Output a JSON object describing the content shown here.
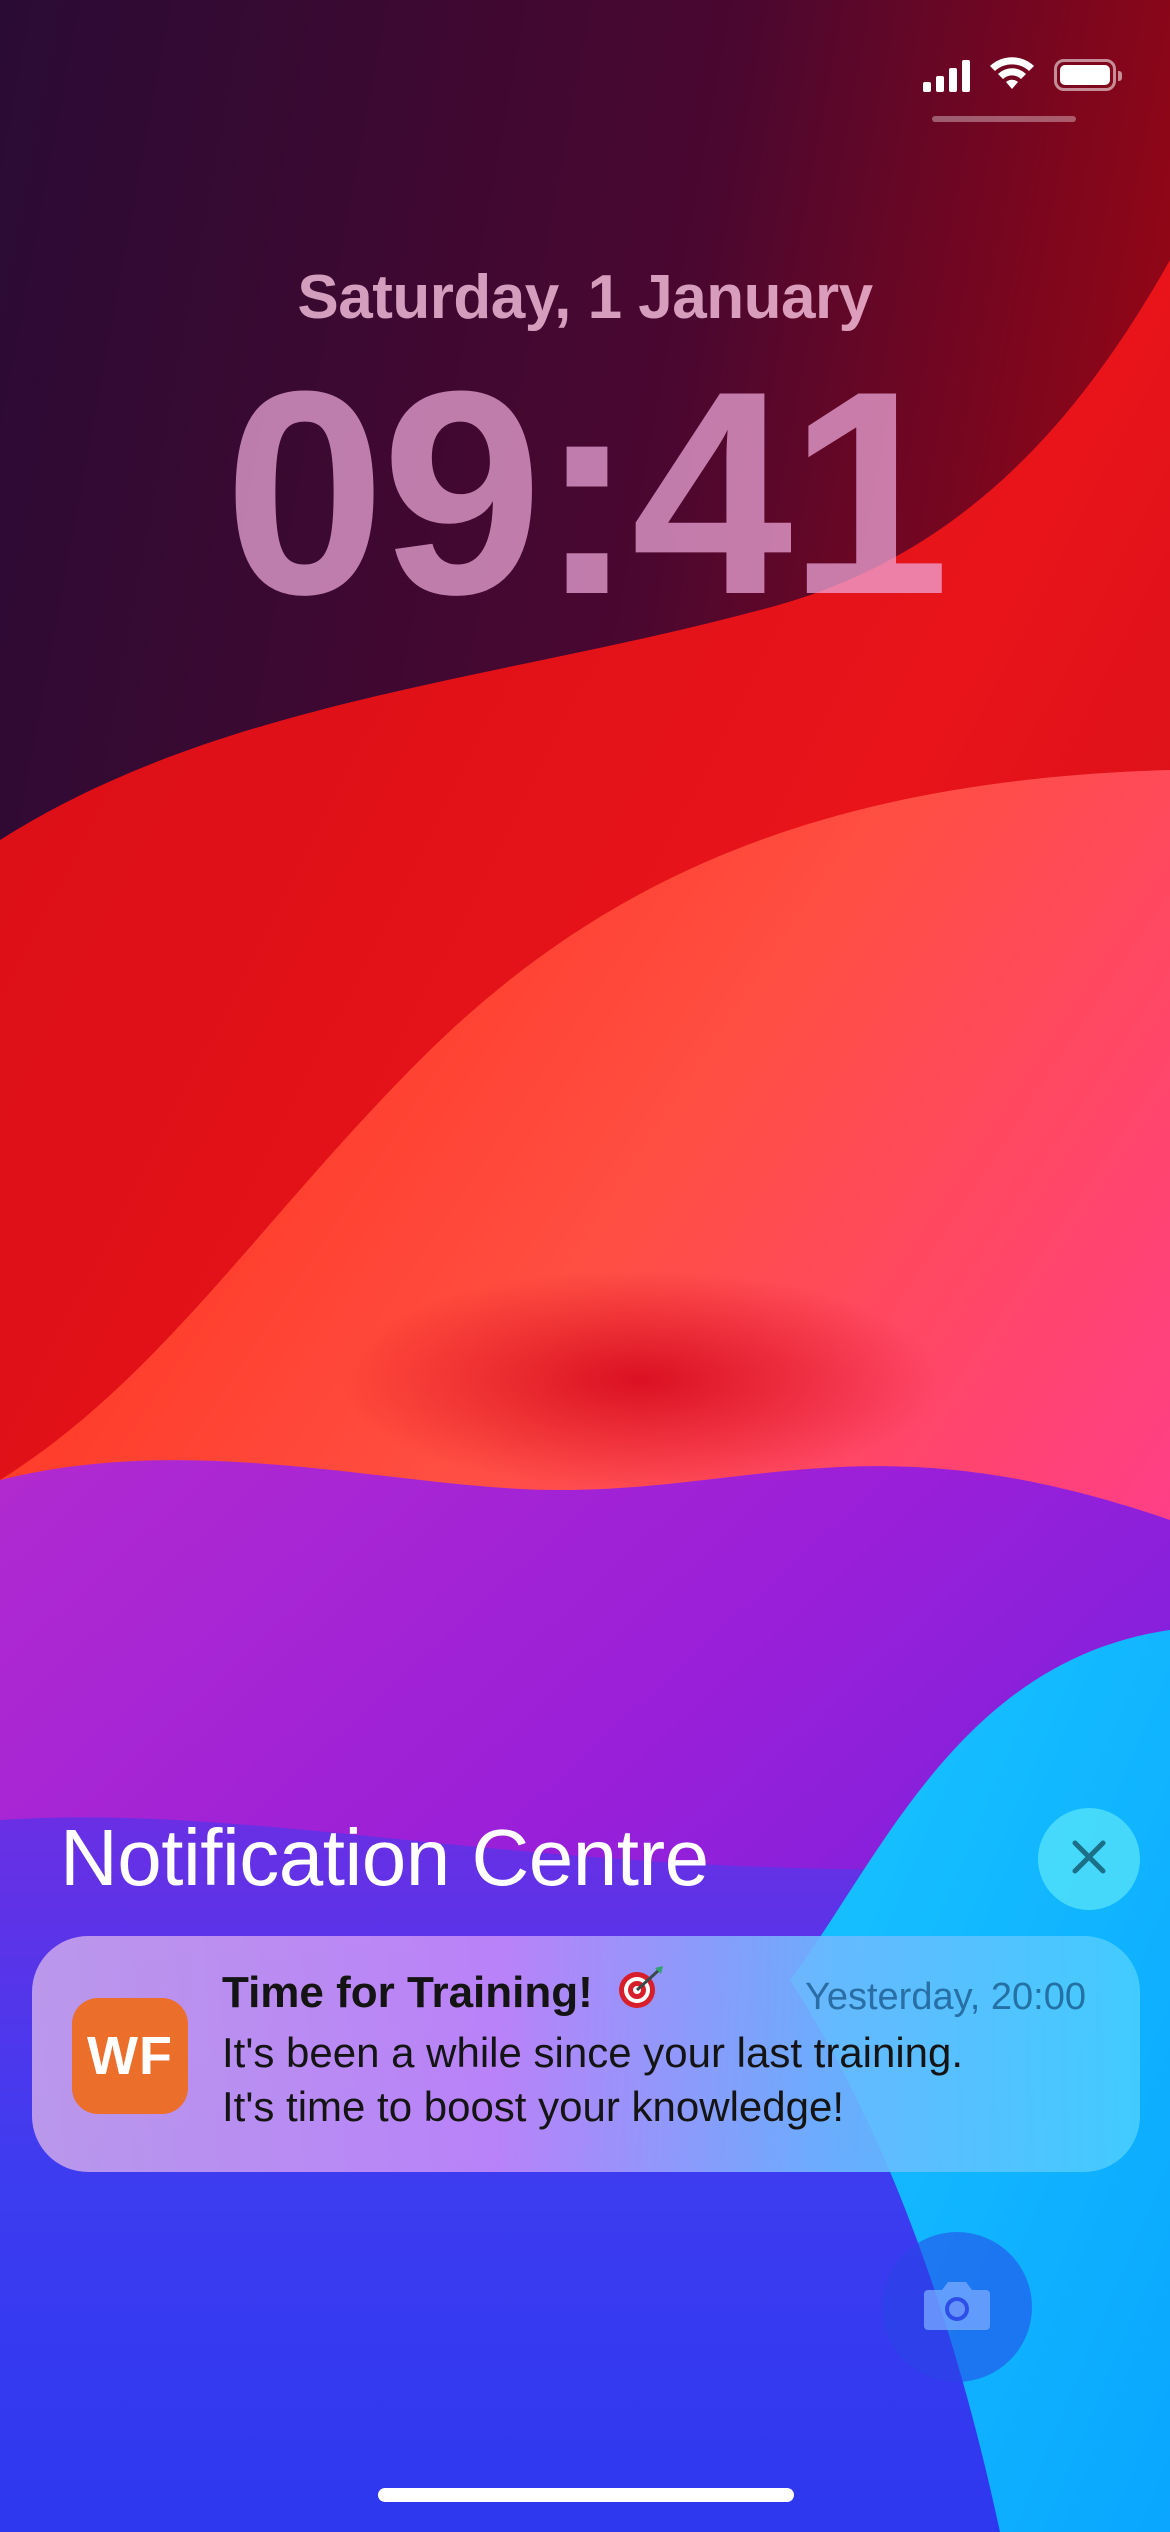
{
  "lock_screen": {
    "date": "Saturday, 1 January",
    "time": "09:41"
  },
  "status_bar": {
    "signal_icon": "cellular-signal-icon",
    "wifi_icon": "wifi-icon",
    "battery_icon": "battery-icon",
    "battery_level": 1.0
  },
  "notification_centre": {
    "title": "Notification Centre",
    "clear_icon": "close-icon"
  },
  "notification": {
    "app_icon_text": "WF",
    "app_icon_color": "#ec6e2b",
    "title": "Time for Training!",
    "title_emoji_icon": "dart-target-icon",
    "timestamp": "Yesterday, 20:00",
    "body_line1": "It's been a while since your last training.",
    "body_line2": "It's time to boost your knowledge!"
  },
  "camera": {
    "icon": "camera-icon"
  }
}
